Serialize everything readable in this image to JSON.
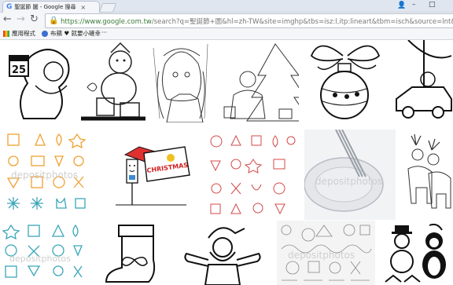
{
  "browser": {
    "tab_title": "聖誕節 圖 - Google 搜尋",
    "tab_icon": "G",
    "tab_close": "×",
    "url_host": "https://www.google.com.tw",
    "url_path": "/search?q=聖誕節+圖&hl=zh-TW&site=imghp&tbs=isz:l,itp:lineart&tbm=isch&source=lnt&sa=X&ved=0",
    "user_icon": "👤",
    "window_controls": [
      "–",
      "□"
    ]
  },
  "bookmarks": [
    {
      "label": "應用程式",
      "icon": "apps-icon"
    },
    {
      "label": "布蘋 ♥ 就要小確幸",
      "icon": "blog-icon"
    },
    {
      "label": "···",
      "icon": "more-icon"
    }
  ],
  "images": {
    "row1": [
      "santa-calendar",
      "snowman-gifts",
      "anime-girl",
      "santa-tree",
      "christmas-ornament",
      "santa-car"
    ],
    "row2": [
      "christmas-icons",
      "snowman-christmas-sign",
      "christmas-pattern",
      "plate-fork",
      "reindeer"
    ],
    "row3": [
      "christmas-icons-2",
      "christmas-stocking",
      "santa-cartoon",
      "doodle-pattern",
      "snowman-penguin"
    ],
    "calendar_number": "25",
    "sign_text": "CHRISTMAS",
    "watermark": "depositphotos"
  },
  "colors": {
    "accent": "#4285f4",
    "secure": "#1e8e3e",
    "orange_line": "#f0a030",
    "teal_line": "#3aa6b8",
    "red_line": "#d44a4a"
  }
}
